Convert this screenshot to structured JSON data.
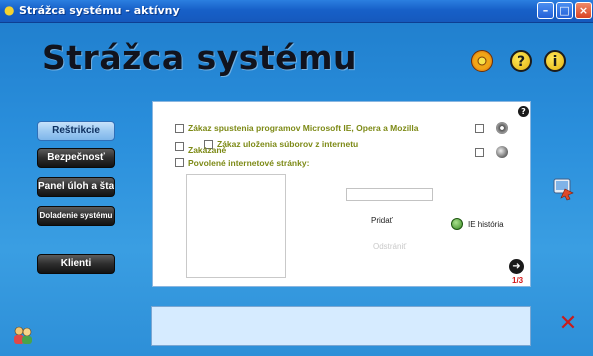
{
  "window": {
    "title": "Strážca systému - aktívny",
    "controls": [
      "minimize",
      "maximize",
      "close"
    ]
  },
  "app_title": "Strážca systému",
  "top_icons": [
    "gear-icon",
    "help-icon",
    "info-icon"
  ],
  "nav": {
    "items": [
      {
        "label": "Reštrikcie",
        "active": true
      },
      {
        "label": "Bezpečnosť",
        "active": false
      },
      {
        "label": "Panel úloh a štart",
        "active": false
      },
      {
        "label": "Doladenie systému",
        "active": false
      },
      {
        "label": "Klienti",
        "active": false
      }
    ]
  },
  "panel": {
    "options": {
      "block_programs": "Zákaz spustenia programov Microsoft IE, Opera a Mozilla",
      "block_downloads": "Zákaz uloženia súborov z internetu",
      "forbidden": "Zakázané",
      "allowed_sites": "Povolené  internetové stránky:"
    },
    "url_input_value": "",
    "add_label": "Pridať",
    "remove_label": "Odstrániť",
    "ie_history_label": "IE história",
    "page_indicator": "1/3"
  },
  "status_text": "",
  "colors": {
    "window_bg": "#2a8fdc",
    "titlebar": "#1760c8",
    "option_text": "#7d8a16",
    "page_indicator": "#d41717",
    "status_bg": "#d6ebff",
    "close_x": "#c81c1c"
  }
}
